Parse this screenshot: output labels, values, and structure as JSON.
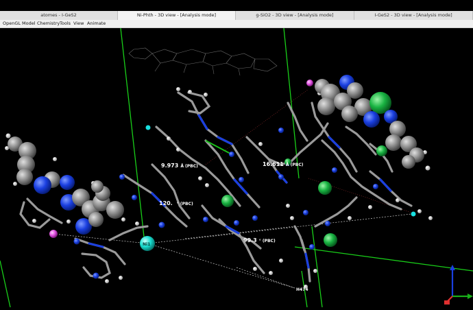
{
  "tabs": [
    {
      "label": "atomes - I-GeS2",
      "active": false
    },
    {
      "label": "Ni-Phth - 3D view - [Analysis mode]",
      "active": true
    },
    {
      "label": "g-SiO2 - 3D view - [Analysis mode]",
      "active": false
    },
    {
      "label": "I-GeS2 - 3D view - [Analysis mode]",
      "active": false
    }
  ],
  "menu": [
    "OpenGL",
    "Model",
    "Chemistry",
    "Tools",
    "View",
    "Animate"
  ],
  "viewport": {
    "measurements": {
      "dist1": "9.973",
      "dist1_unit": "Å (PBC)",
      "dist2": "16.611",
      "dist2_unit": "Å (PBC)",
      "angle1": "120.",
      "angle1_unit": "° (PBC)",
      "angle2": "99.3",
      "angle2_unit": "° (PBC)"
    },
    "atom_labels": {
      "ni1": "Ni1",
      "h474": "H474"
    },
    "colors": {
      "carbon": "#8f8f8f",
      "nitrogen": "#1a3fe0",
      "nickel": "#19b342",
      "hydrogen": "#ffffff",
      "selected": "#19e0d2",
      "highlight": "#e052e0",
      "cell": "#19e019"
    }
  }
}
